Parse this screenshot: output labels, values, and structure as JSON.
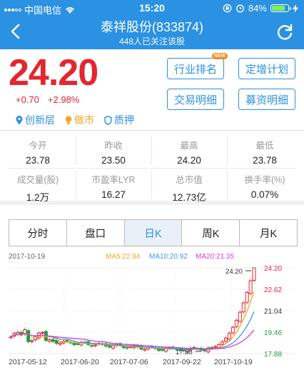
{
  "status_bar": {
    "carrier": "中国电信",
    "time": "15:20",
    "battery": "84%",
    "battery_level": 0.84
  },
  "header": {
    "title": "泰祥股份(833874)",
    "subtitle": "448人已关注该股"
  },
  "quote": {
    "price": "24.20",
    "change": "+0.70",
    "change_pct": "+2.98%"
  },
  "tags": [
    "创新层",
    "做市",
    "质押"
  ],
  "buttons": {
    "industry_rank": "行业排名",
    "new_badge": "NEW",
    "placement_plan": "定增计划",
    "trade_detail": "交易明细",
    "fund_detail": "募资明细"
  },
  "stats": [
    {
      "label": "今开",
      "value": "23.78"
    },
    {
      "label": "昨收",
      "value": "23.50"
    },
    {
      "label": "最高",
      "value": "24.20"
    },
    {
      "label": "最低",
      "value": "23.78"
    },
    {
      "label": "成交量(股)",
      "value": "1.2万"
    },
    {
      "label": "市盈率LYR",
      "value": "16.27"
    },
    {
      "label": "总市值",
      "value": "12.73亿"
    },
    {
      "label": "换手率(%)",
      "value": "0.07%"
    }
  ],
  "tabs": [
    "分时",
    "盘口",
    "日K",
    "周K",
    "月K"
  ],
  "active_tab": "日K",
  "chart": {
    "date": "2017-10-19",
    "ma5": "MA5:22.94",
    "ma10": "MA10:20.92",
    "ma20": "MA20:21.35",
    "y_ticks": [
      "24.20",
      "22.62",
      "21.04",
      "19.46",
      "17.88"
    ],
    "high_marker": "24.20",
    "low_marker": "17.88",
    "x_ticks": [
      "2017-05-12",
      "2017-06-20",
      "2017-07-06",
      "2017-09-22",
      "2017-10-19"
    ],
    "colors": {
      "up": "#e3262f",
      "down": "#1f9e3a",
      "ma5": "#f5a623",
      "ma10": "#3b9be6",
      "ma20": "#d63ecf"
    }
  }
}
